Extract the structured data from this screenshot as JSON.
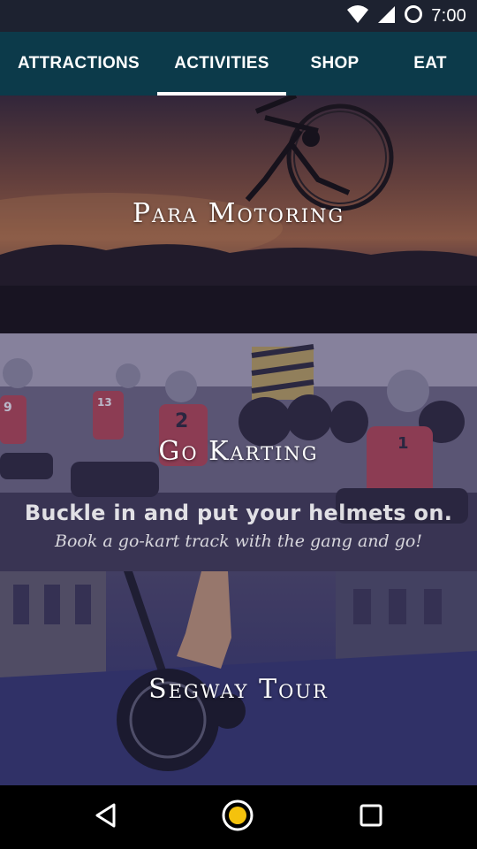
{
  "status_bar": {
    "time": "7:00"
  },
  "tabs": [
    {
      "label": "ATTRACTIONS",
      "selected": false
    },
    {
      "label": "ACTIVITIES",
      "selected": true
    },
    {
      "label": "SHOP",
      "selected": false
    },
    {
      "label": "EAT",
      "selected": false
    }
  ],
  "cards": [
    {
      "title": "Para Motoring"
    },
    {
      "title": "Go Karting",
      "image_text_1": "Buckle in and put your helmets on.",
      "image_text_2": "Book a go-kart track with the gang and go!",
      "image_number_1": "9",
      "image_number_2": "13",
      "image_number_3": "2",
      "image_number_4": "1"
    },
    {
      "title": "Segway Tour"
    }
  ],
  "icons": {
    "wifi": "wifi-icon",
    "signal": "signal-icon",
    "sync": "sync-icon",
    "back": "back-triangle-icon",
    "home": "home-circle-icon",
    "recents": "recents-square-icon"
  },
  "colors": {
    "status_bar": "#1d2230",
    "tab_bar": "#0c3a4a",
    "tab_indicator": "#ffffff",
    "nav_bar": "#000000",
    "home_accent": "#f4c20d"
  }
}
